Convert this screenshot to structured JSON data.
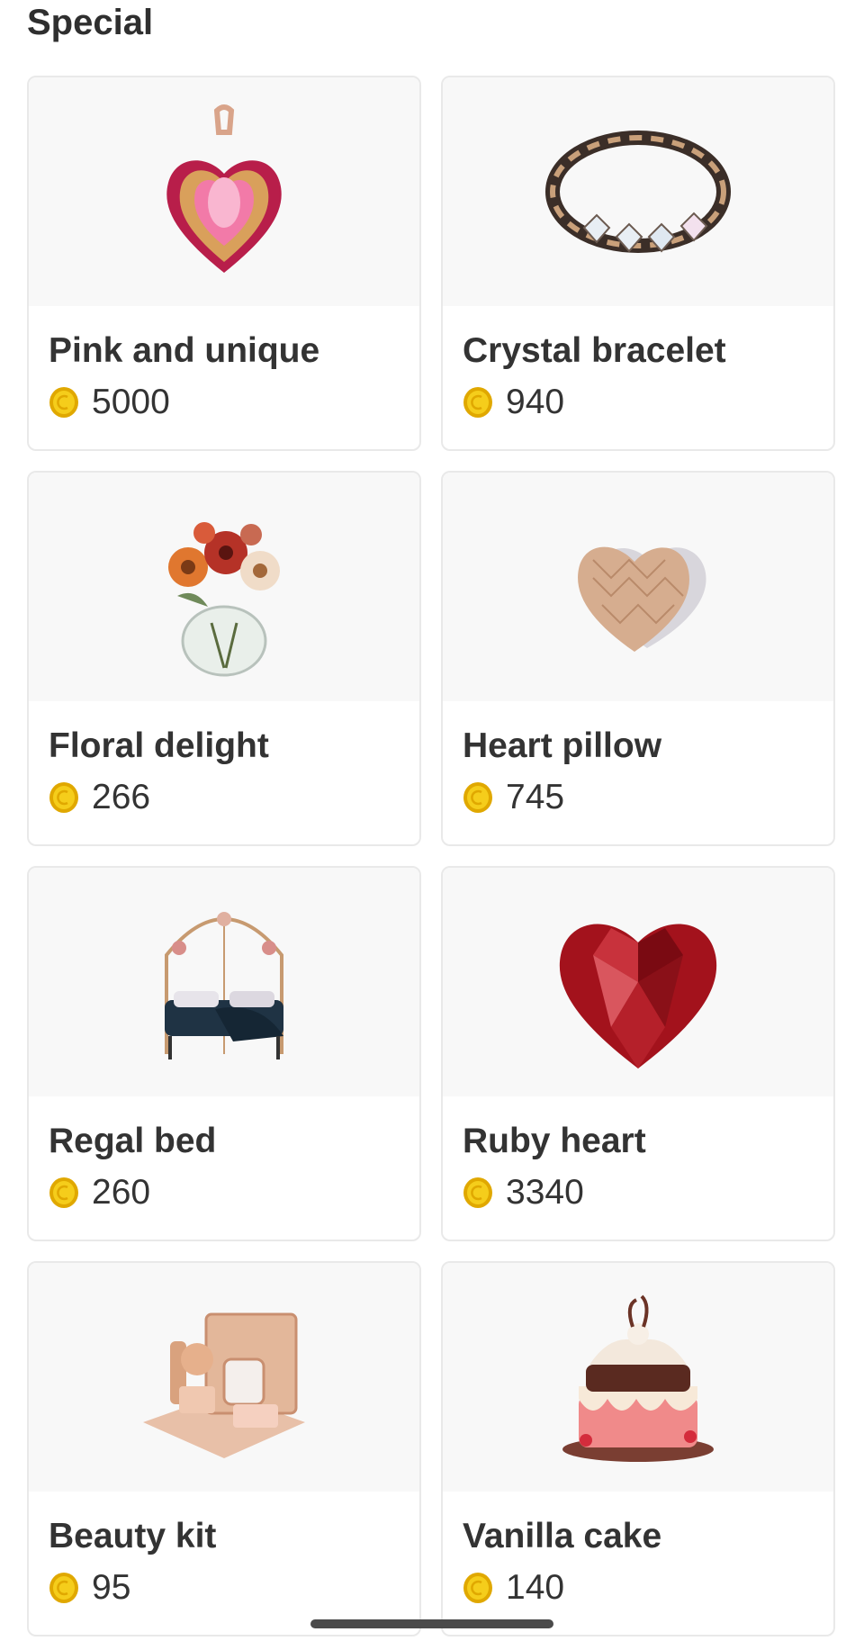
{
  "section": {
    "title": "Special"
  },
  "items": [
    {
      "name": "Pink and unique",
      "price": "5000",
      "icon": "pink-heart-pendant-icon"
    },
    {
      "name": "Crystal bracelet",
      "price": "940",
      "icon": "crystal-bracelet-icon"
    },
    {
      "name": "Floral delight",
      "price": "266",
      "icon": "flower-vase-icon"
    },
    {
      "name": "Heart pillow",
      "price": "745",
      "icon": "heart-pillow-icon"
    },
    {
      "name": "Regal bed",
      "price": "260",
      "icon": "canopy-bed-icon"
    },
    {
      "name": "Ruby heart",
      "price": "3340",
      "icon": "ruby-heart-icon"
    },
    {
      "name": "Beauty kit",
      "price": "95",
      "icon": "beauty-kit-icon"
    },
    {
      "name": "Vanilla cake",
      "price": "140",
      "icon": "vanilla-cake-icon"
    }
  ],
  "colors": {
    "coin": "#f2c200",
    "coin_rim": "#e0a800",
    "card_border": "#e9e9e9",
    "thumb_bg": "#f8f8f8"
  }
}
